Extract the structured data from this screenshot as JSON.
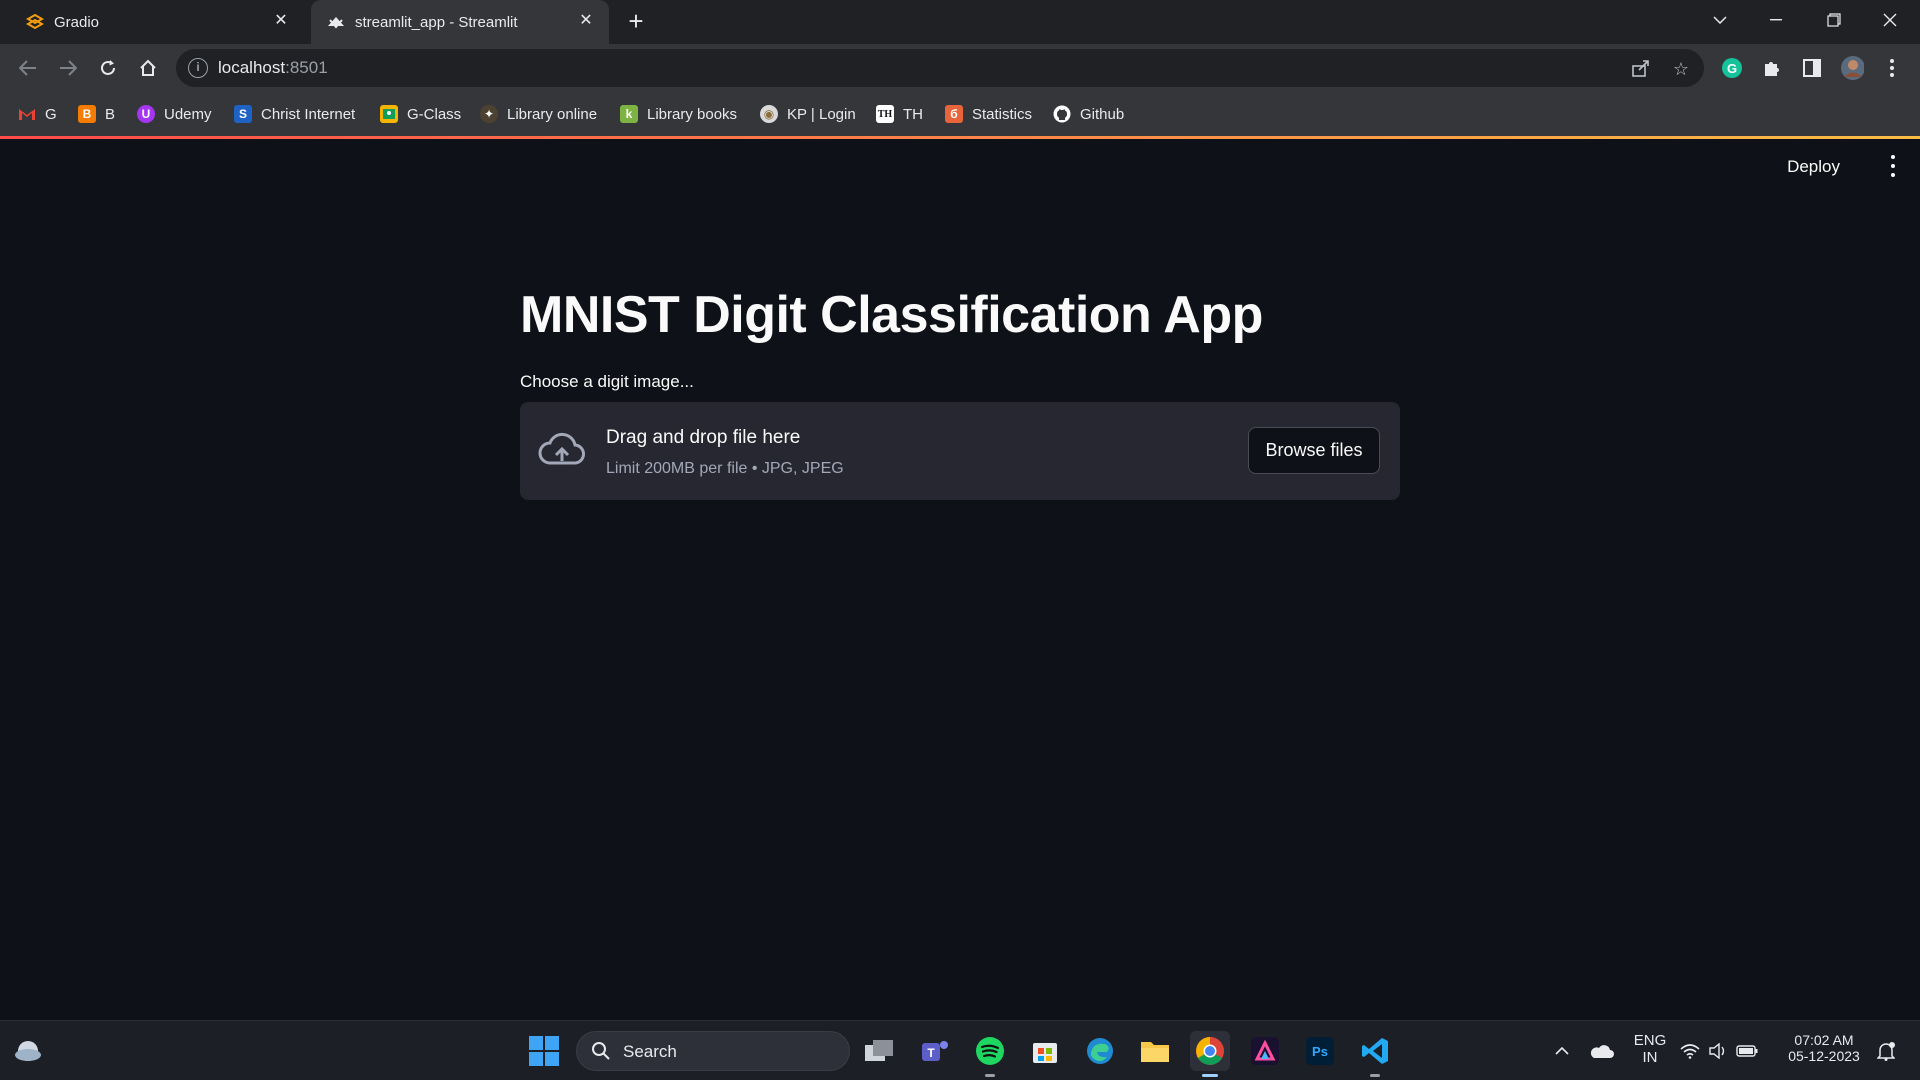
{
  "browser": {
    "tabs": [
      {
        "title": "Gradio",
        "active": false
      },
      {
        "title": "streamlit_app - Streamlit",
        "active": true
      }
    ],
    "url_host": "localhost",
    "url_port": ":8501",
    "bookmarks": [
      {
        "label": "G",
        "icon": "gmail-icon",
        "color": "#ea4335"
      },
      {
        "label": "B",
        "icon": "blogger-icon",
        "color": "#f57c00"
      },
      {
        "label": "Udemy",
        "icon": "udemy-icon",
        "color": "#a435f0"
      },
      {
        "label": "Christ Internet",
        "icon": "christ-icon",
        "color": "#1e63c4"
      },
      {
        "label": "G-Class",
        "icon": "classroom-icon",
        "color": "#f4b400"
      },
      {
        "label": "Library online",
        "icon": "library-icon",
        "color": "#6d5a3d"
      },
      {
        "label": "Library books",
        "icon": "koha-icon",
        "color": "#7cb342"
      },
      {
        "label": "KP | Login",
        "icon": "kp-icon",
        "color": "#d9d9d9"
      },
      {
        "label": "TH",
        "icon": "th-icon",
        "color": "#ffffff"
      },
      {
        "label": "Statistics",
        "icon": "statistics-icon",
        "color": "#e8653b"
      },
      {
        "label": "Github",
        "icon": "github-icon",
        "color": "#ffffff"
      }
    ]
  },
  "app": {
    "deploy_label": "Deploy",
    "title": "MNIST Digit Classification App",
    "uploader_label": "Choose a digit image...",
    "dropzone_title": "Drag and drop file here",
    "dropzone_limit": "Limit 200MB per file • JPG, JPEG",
    "browse_label": "Browse files",
    "accent_colors": [
      "#ff4b4b",
      "#ffbd45"
    ]
  },
  "taskbar": {
    "search_placeholder": "Search",
    "language_line1": "ENG",
    "language_line2": "IN",
    "time": "07:02 AM",
    "date": "05-12-2023"
  }
}
